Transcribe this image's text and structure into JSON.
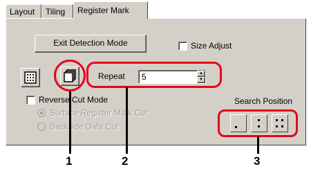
{
  "tabs": [
    {
      "label": "Layout",
      "active": false
    },
    {
      "label": "Tiling",
      "active": false
    },
    {
      "label": "Register Mark",
      "active": true
    }
  ],
  "buttons": {
    "exit_detection": "Exit Detection Mode"
  },
  "checkboxes": {
    "size_adjust": "Size Adjust",
    "reverse_cut": "Reverse Cut Mode"
  },
  "repeat": {
    "label": "Repeat",
    "value": "5"
  },
  "radios": [
    {
      "label": "Surface Register Mark Cut",
      "selected": true,
      "enabled": false
    },
    {
      "label": "Backside Data Cut",
      "selected": false,
      "enabled": false
    }
  ],
  "search_position": {
    "label": "Search Position",
    "options": [
      "one-point",
      "two-point",
      "four-point"
    ]
  },
  "callouts": [
    "1",
    "2",
    "3"
  ],
  "colors": {
    "highlight": "#e8001c",
    "panel": "#d4d0c8"
  }
}
